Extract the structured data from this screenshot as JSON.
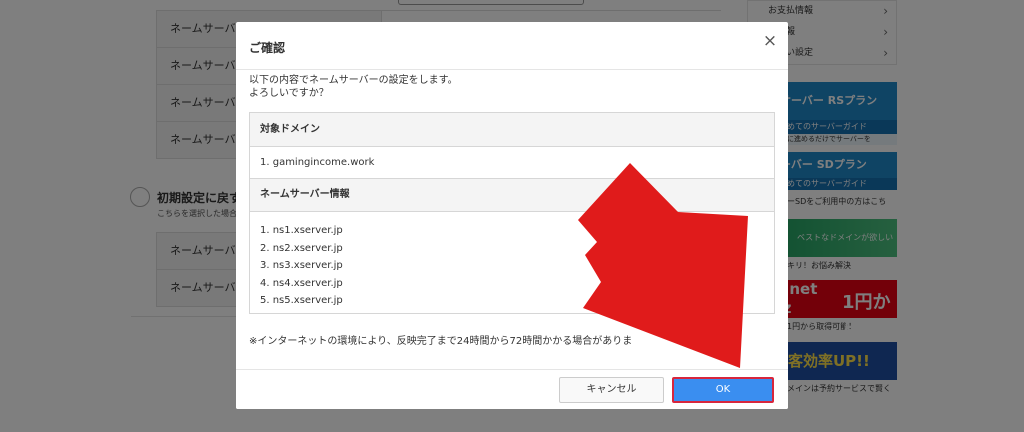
{
  "background": {
    "nameserver_label": "ネームサーバー",
    "nameserver_rows_top": [
      "ネームサーバー",
      "ネームサーバー",
      "ネームサーバー",
      "ネームサーバー"
    ],
    "init_option_title": "初期設定に戻す",
    "init_option_sub": "こちらを選択した場合",
    "nameserver_rows_bottom": [
      "ネームサーバー",
      "ネームサーバー"
    ]
  },
  "sidebar": {
    "menu": [
      {
        "label": "お支払情報"
      },
      {
        "label": "求情報"
      },
      {
        "label": "の払い設定"
      }
    ],
    "banners": {
      "rs_title": "ルサーバー RSプラン",
      "rs_mid": "めてのサーバーガイド",
      "rs_sub": "に進めるだけでサーバーを",
      "sd_title": "サーバー SDプラン",
      "sd_mid": "めてのサーバーガイド",
      "sd_sub": "ーSDをご利用中の方はこち",
      "domain_text": "ベストなドメインが欲しい",
      "domain_sub": "キリ！お悩み解決",
      "net_text": "n.net",
      "net_text2": "yz",
      "net_price": "1円から",
      "net_sub": "1円から取得可能！",
      "up_text": "集客効率UP!!",
      "up_sub": "メインは予約サービスで賢く"
    }
  },
  "modal": {
    "title": "ご確認",
    "close_symbol": "×",
    "intro_line1": "以下の内容でネームサーバーの設定をします。",
    "intro_line2": "よろしいですか？",
    "domain_heading": "対象ドメイン",
    "domain_value": "1. gamingincome.work",
    "ns_heading": "ネームサーバー情報",
    "nameservers": [
      "1. ns1.xserver.jp",
      "2. ns2.xserver.jp",
      "3. ns3.xserver.jp",
      "4. ns4.xserver.jp",
      "5. ns5.xserver.jp"
    ],
    "note": "※インターネットの環境により、反映完了まで24時間から72時間かかる場合がありま",
    "cancel_label": "キャンセル",
    "ok_label": "OK"
  },
  "colors": {
    "ok_button": "#3a8ef0",
    "ok_highlight_border": "#d7263d",
    "annotation_arrow": "#e01b1b"
  }
}
